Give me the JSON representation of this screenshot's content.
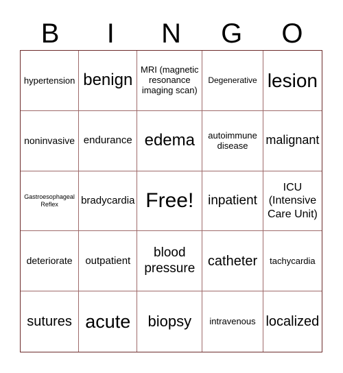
{
  "header": {
    "letters": [
      "B",
      "I",
      "N",
      "G",
      "O"
    ]
  },
  "grid_color": "#6b2a2a",
  "cells": [
    "hypertension",
    "benign",
    "MRI (magnetic resonance imaging scan)",
    "Degenerative",
    "lesion",
    "noninvasive",
    "endurance",
    "edema",
    "autoimmune disease",
    "malignant",
    "Gastroesophageal Reflex",
    "bradycardia",
    "Free!",
    "inpatient",
    "ICU (Intensive Care Unit)",
    "deteriorate",
    "outpatient",
    "blood pressure",
    "catheter",
    "tachycardia",
    "sutures",
    "acute",
    "biopsy",
    "intravenous",
    "localized"
  ]
}
